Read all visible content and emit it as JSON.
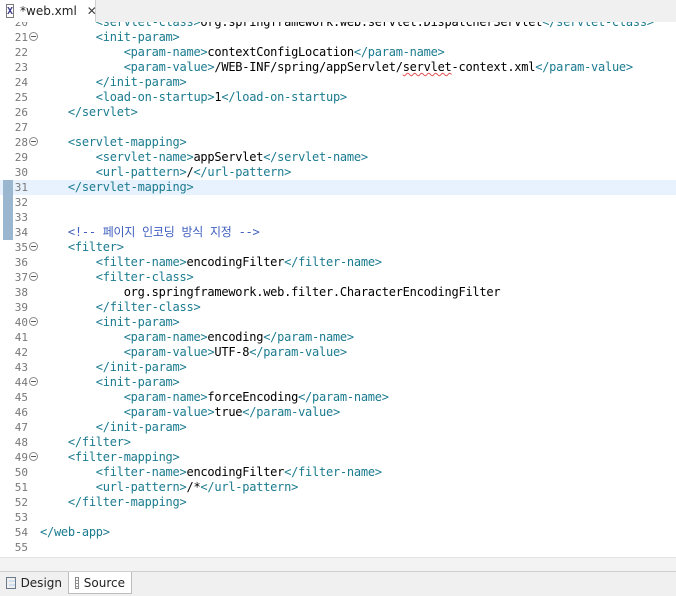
{
  "tab": {
    "title": "*web.xml",
    "close": "✕",
    "icon_letter": "X"
  },
  "bottom_tabs": {
    "design": "Design",
    "source": "Source"
  },
  "lines": [
    {
      "n": "20",
      "fold": false,
      "segs": [
        [
          "tag",
          "        <servlet-class>"
        ],
        [
          "txt",
          "org.springframework.web.servlet.DispatcherServlet"
        ],
        [
          "tag",
          "</servlet-class>"
        ]
      ]
    },
    {
      "n": "21",
      "fold": true,
      "segs": [
        [
          "tag",
          "        <init-param>"
        ]
      ]
    },
    {
      "n": "22",
      "fold": false,
      "segs": [
        [
          "tag",
          "            <param-name>"
        ],
        [
          "txt",
          "contextConfigLocation"
        ],
        [
          "tag",
          "</param-name>"
        ]
      ]
    },
    {
      "n": "23",
      "fold": false,
      "segs": [
        [
          "tag",
          "            <param-value>"
        ],
        [
          "txt",
          "/WEB-INF/spring/appServlet/"
        ],
        [
          "squig",
          "servlet"
        ],
        [
          "txt",
          "-context.xml"
        ],
        [
          "tag",
          "</param-value>"
        ]
      ]
    },
    {
      "n": "24",
      "fold": false,
      "segs": [
        [
          "tag",
          "        </init-param>"
        ]
      ]
    },
    {
      "n": "25",
      "fold": false,
      "segs": [
        [
          "tag",
          "        <load-on-startup>"
        ],
        [
          "txt",
          "1"
        ],
        [
          "tag",
          "</load-on-startup>"
        ]
      ]
    },
    {
      "n": "26",
      "fold": false,
      "segs": [
        [
          "tag",
          "    </servlet>"
        ]
      ]
    },
    {
      "n": "27",
      "fold": false,
      "segs": []
    },
    {
      "n": "28",
      "fold": true,
      "segs": [
        [
          "tag",
          "    <servlet-mapping>"
        ]
      ]
    },
    {
      "n": "29",
      "fold": false,
      "segs": [
        [
          "tag",
          "        <servlet-name>"
        ],
        [
          "txt",
          "appServlet"
        ],
        [
          "tag",
          "</servlet-name>"
        ]
      ]
    },
    {
      "n": "30",
      "fold": false,
      "segs": [
        [
          "tag",
          "        <url-pattern>"
        ],
        [
          "txt",
          "/"
        ],
        [
          "tag",
          "</url-pattern>"
        ]
      ]
    },
    {
      "n": "31",
      "fold": false,
      "current": true,
      "mark": true,
      "segs": [
        [
          "tag",
          "    </servlet-mapping>"
        ]
      ]
    },
    {
      "n": "32",
      "fold": false,
      "mark": true,
      "segs": []
    },
    {
      "n": "33",
      "fold": false,
      "mark": true,
      "segs": []
    },
    {
      "n": "34",
      "fold": false,
      "mark": true,
      "segs": [
        [
          "cmt",
          "    <!-- 페이지 인코딩 방식 지정 -->"
        ]
      ]
    },
    {
      "n": "35",
      "fold": true,
      "segs": [
        [
          "tag",
          "    <filter>"
        ]
      ]
    },
    {
      "n": "36",
      "fold": false,
      "segs": [
        [
          "tag",
          "        <filter-name>"
        ],
        [
          "txt",
          "encodingFilter"
        ],
        [
          "tag",
          "</filter-name>"
        ]
      ]
    },
    {
      "n": "37",
      "fold": true,
      "segs": [
        [
          "tag",
          "        <filter-class>"
        ]
      ]
    },
    {
      "n": "38",
      "fold": false,
      "segs": [
        [
          "txt",
          "            org.springframework.web.filter.CharacterEncodingFilter"
        ]
      ]
    },
    {
      "n": "39",
      "fold": false,
      "segs": [
        [
          "tag",
          "        </filter-class>"
        ]
      ]
    },
    {
      "n": "40",
      "fold": true,
      "segs": [
        [
          "tag",
          "        <init-param>"
        ]
      ]
    },
    {
      "n": "41",
      "fold": false,
      "segs": [
        [
          "tag",
          "            <param-name>"
        ],
        [
          "txt",
          "encoding"
        ],
        [
          "tag",
          "</param-name>"
        ]
      ]
    },
    {
      "n": "42",
      "fold": false,
      "segs": [
        [
          "tag",
          "            <param-value>"
        ],
        [
          "txt",
          "UTF-8"
        ],
        [
          "tag",
          "</param-value>"
        ]
      ]
    },
    {
      "n": "43",
      "fold": false,
      "segs": [
        [
          "tag",
          "        </init-param>"
        ]
      ]
    },
    {
      "n": "44",
      "fold": true,
      "segs": [
        [
          "tag",
          "        <init-param>"
        ]
      ]
    },
    {
      "n": "45",
      "fold": false,
      "segs": [
        [
          "tag",
          "            <param-name>"
        ],
        [
          "txt",
          "forceEncoding"
        ],
        [
          "tag",
          "</param-name>"
        ]
      ]
    },
    {
      "n": "46",
      "fold": false,
      "segs": [
        [
          "tag",
          "            <param-value>"
        ],
        [
          "txt",
          "true"
        ],
        [
          "tag",
          "</param-value>"
        ]
      ]
    },
    {
      "n": "47",
      "fold": false,
      "segs": [
        [
          "tag",
          "        </init-param>"
        ]
      ]
    },
    {
      "n": "48",
      "fold": false,
      "segs": [
        [
          "tag",
          "    </filter>"
        ]
      ]
    },
    {
      "n": "49",
      "fold": true,
      "segs": [
        [
          "tag",
          "    <filter-mapping>"
        ]
      ]
    },
    {
      "n": "50",
      "fold": false,
      "segs": [
        [
          "tag",
          "        <filter-name>"
        ],
        [
          "txt",
          "encodingFilter"
        ],
        [
          "tag",
          "</filter-name>"
        ]
      ]
    },
    {
      "n": "51",
      "fold": false,
      "segs": [
        [
          "tag",
          "        <url-pattern>"
        ],
        [
          "txt",
          "/*"
        ],
        [
          "tag",
          "</url-pattern>"
        ]
      ]
    },
    {
      "n": "52",
      "fold": false,
      "segs": [
        [
          "tag",
          "    </filter-mapping>"
        ]
      ]
    },
    {
      "n": "53",
      "fold": false,
      "segs": []
    },
    {
      "n": "54",
      "fold": false,
      "segs": [
        [
          "tag",
          "</web-app>"
        ]
      ]
    },
    {
      "n": "55",
      "fold": false,
      "segs": []
    }
  ]
}
